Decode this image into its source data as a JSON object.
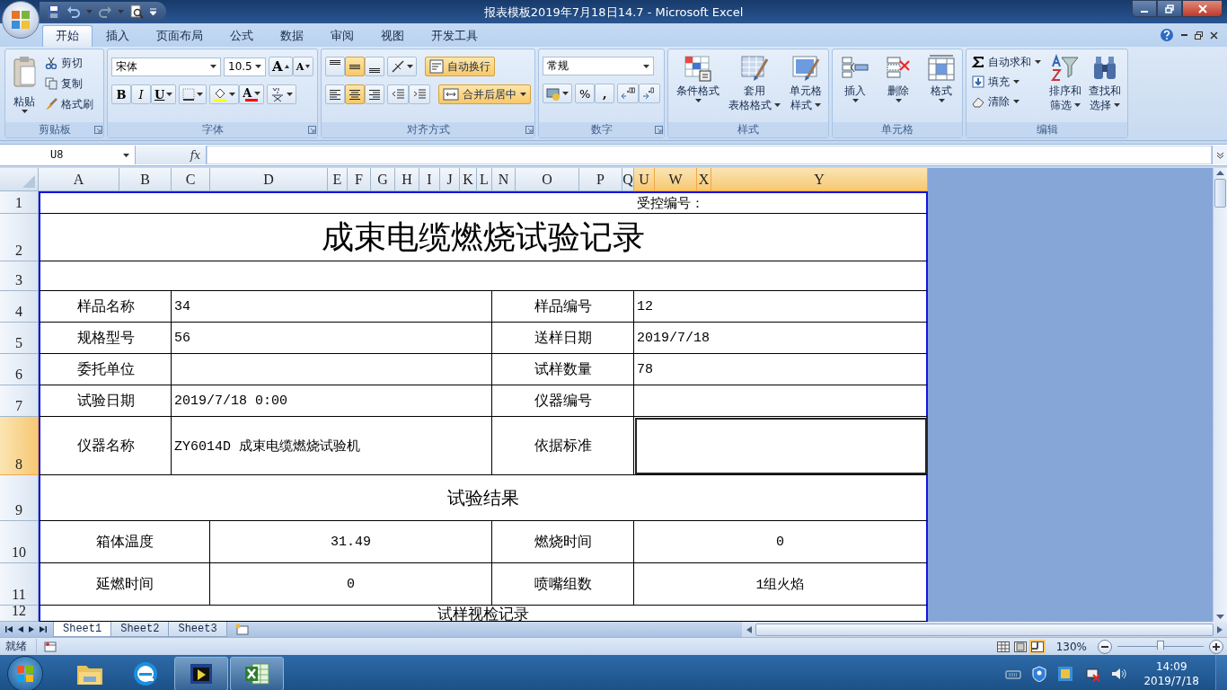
{
  "window": {
    "title": "报表模板2019年7月18日14.7 - Microsoft Excel"
  },
  "ribbon_tabs": [
    {
      "label": "开始",
      "selected": true
    },
    {
      "label": "插入",
      "selected": false
    },
    {
      "label": "页面布局",
      "selected": false
    },
    {
      "label": "公式",
      "selected": false
    },
    {
      "label": "数据",
      "selected": false
    },
    {
      "label": "审阅",
      "selected": false
    },
    {
      "label": "视图",
      "selected": false
    },
    {
      "label": "开发工具",
      "selected": false
    }
  ],
  "ribbon_groups": [
    {
      "kind": "clipboard",
      "label": "剪贴板",
      "paste": "粘贴",
      "items": [
        "剪切",
        "复制",
        "格式刷"
      ]
    },
    {
      "kind": "font",
      "label": "字体",
      "font_name": "宋体",
      "font_size": "10.5",
      "grow": "A",
      "shrink": "A",
      "bold": "B",
      "italic": "I",
      "underline": "U",
      "font_color": "A"
    },
    {
      "kind": "alignment",
      "label": "对齐方式",
      "vertical": [
        {
          "selected": false
        },
        {
          "selected": true
        },
        {
          "selected": false
        }
      ],
      "horizontal": [
        {
          "selected": false
        },
        {
          "selected": true
        },
        {
          "selected": false
        }
      ],
      "wrap": {
        "label": "自动换行",
        "selected": true
      },
      "merge": {
        "label": "合并后居中",
        "selected": true
      }
    },
    {
      "kind": "number",
      "label": "数字",
      "format": "常规",
      "percent": "%",
      "comma": ","
    },
    {
      "kind": "large",
      "label": "样式",
      "buttons": [
        {
          "kind": "conditional",
          "lines": [
            "条件格式"
          ]
        },
        {
          "kind": "table",
          "lines": [
            "套用",
            "表格格式"
          ]
        },
        {
          "kind": "cellstyle",
          "lines": [
            "单元格",
            "样式"
          ]
        }
      ]
    },
    {
      "kind": "large",
      "label": "单元格",
      "buttons": [
        {
          "kind": "insert",
          "lines": [
            "插入"
          ]
        },
        {
          "kind": "delete",
          "lines": [
            "删除"
          ]
        },
        {
          "kind": "format",
          "lines": [
            "格式"
          ]
        }
      ]
    },
    {
      "kind": "editing",
      "label": "编辑",
      "small": [
        {
          "kind": "sum",
          "label": "自动求和"
        },
        {
          "kind": "fill",
          "label": "填充"
        },
        {
          "kind": "clear",
          "label": "清除"
        }
      ],
      "buttons": [
        {
          "kind": "sort",
          "lines": [
            "排序和",
            "筛选"
          ]
        },
        {
          "kind": "find",
          "lines": [
            "查找和",
            "选择"
          ]
        }
      ]
    }
  ],
  "formula_bar": {
    "name_box": "U8",
    "fx": "fx"
  },
  "columns": [
    {
      "letter": "A",
      "selected": false
    },
    {
      "letter": "B",
      "selected": false
    },
    {
      "letter": "C",
      "selected": false
    },
    {
      "letter": "D",
      "selected": false
    },
    {
      "letter": "E",
      "selected": false
    },
    {
      "letter": "F",
      "selected": false
    },
    {
      "letter": "G",
      "selected": false
    },
    {
      "letter": "H",
      "selected": false
    },
    {
      "letter": "I",
      "selected": false
    },
    {
      "letter": "J",
      "selected": false
    },
    {
      "letter": "K",
      "selected": false
    },
    {
      "letter": "L",
      "selected": false
    },
    {
      "letter": "N",
      "selected": false
    },
    {
      "letter": "O",
      "selected": false
    },
    {
      "letter": "P",
      "selected": false
    },
    {
      "letter": "Q",
      "selected": false
    },
    {
      "letter": "U",
      "selected": true
    },
    {
      "letter": "W",
      "selected": true
    },
    {
      "letter": "X",
      "selected": true
    },
    {
      "letter": "Y",
      "selected": true
    }
  ],
  "rows": [
    {
      "number": "1",
      "selected": false,
      "kind": "note",
      "cells": [
        "受控编号："
      ]
    },
    {
      "number": "2",
      "selected": false,
      "kind": "title",
      "cells": [
        "成束电缆燃烧试验记录"
      ]
    },
    {
      "number": "3",
      "selected": false,
      "kind": "blank"
    },
    {
      "number": "4",
      "selected": false,
      "kind": "pair",
      "cells": [
        "样品名称",
        "34",
        "样品编号",
        "12"
      ]
    },
    {
      "number": "5",
      "selected": false,
      "kind": "pair",
      "cells": [
        "规格型号",
        "56",
        "送样日期",
        "2019/7/18"
      ]
    },
    {
      "number": "6",
      "selected": false,
      "kind": "pair",
      "cells": [
        "委托单位",
        null,
        "试样数量",
        "78"
      ]
    },
    {
      "number": "7",
      "selected": false,
      "kind": "pair",
      "cells": [
        "试验日期",
        "2019/7/18 0:00",
        "仪器编号",
        null
      ]
    },
    {
      "number": "8",
      "selected": true,
      "kind": "pair",
      "cells": [
        "仪器名称",
        "ZY6014D 成束电缆燃烧试验机",
        "依据标准",
        null
      ]
    },
    {
      "number": "9",
      "selected": false,
      "kind": "heading",
      "cells": [
        "试验结果"
      ]
    },
    {
      "number": "10",
      "selected": false,
      "kind": "pair_centered",
      "cells": [
        "箱体温度",
        "31.49",
        "燃烧时间",
        "0"
      ]
    },
    {
      "number": "11",
      "selected": false,
      "kind": "pair_centered",
      "cells": [
        "延燃时间",
        "0",
        "喷嘴组数",
        "1组火焰"
      ]
    },
    {
      "number": "12",
      "selected": false,
      "kind": "heading",
      "cells": [
        "试样视检记录"
      ]
    }
  ],
  "sheet_tabs": [
    {
      "label": "Sheet1",
      "selected": true
    },
    {
      "label": "Sheet2",
      "selected": false
    },
    {
      "label": "Sheet3",
      "selected": false
    }
  ],
  "status_bar": {
    "text": "就绪",
    "zoom": "130%",
    "zoom_slider": {
      "level": 0.5
    }
  },
  "taskbar": {
    "apps": [
      {
        "kind": "folder",
        "active": false
      },
      {
        "kind": "ie",
        "active": false
      },
      {
        "kind": "media",
        "active": true
      },
      {
        "kind": "excel",
        "active": true
      }
    ],
    "time": "14:09",
    "date": "2019/7/18"
  }
}
